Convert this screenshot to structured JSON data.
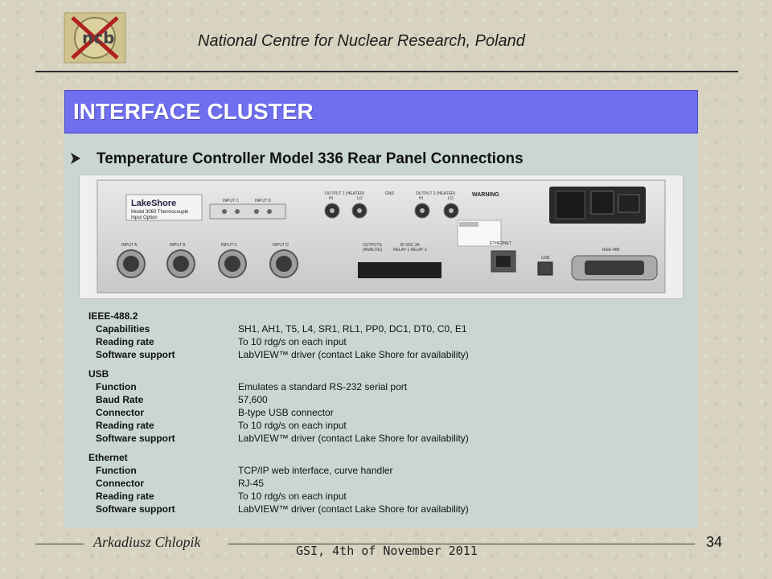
{
  "header": {
    "logo_icon": "ncbj-logo",
    "org_title": "National Centre for Nuclear Research, Poland"
  },
  "slide": {
    "title": "INTERFACE CLUSTER",
    "title_bar_color": "#6f6ff0",
    "bullet_icon": "arrow-bullet-icon",
    "subtitle": "Temperature Controller Model 336 Rear Panel Connections"
  },
  "device": {
    "brand": "LakeShore",
    "module_line1": "Model 3060 Thermocouple",
    "module_line2": "Input Option",
    "top_input_c": "INPUT C",
    "top_input_d": "INPUT D",
    "output1": "OUTPUT 1 (HEATER)",
    "output2": "OUTPUT 2 (HEATER)",
    "hi": "HI",
    "lo": "LO",
    "gnd": "GND",
    "warning": "WARNING",
    "input_a": "INPUT A",
    "input_b": "INPUT B",
    "input_c": "INPUT C",
    "input_d": "INPUT D",
    "outputs": "OUTPUTS",
    "analog": "(ANALOG)",
    "relay_header": "30 VDC 3A",
    "relays": "RELAY 1   RELAY 2",
    "ethernet": "ETHERNET",
    "usb": "USB",
    "ieee": "IEEE-488"
  },
  "specs": [
    {
      "heading": "IEEE-488.2",
      "rows": [
        {
          "key": "Capabilities",
          "value": "SH1, AH1, T5, L4, SR1, RL1, PP0, DC1, DT0, C0, E1"
        },
        {
          "key": "Reading rate",
          "value": "To 10 rdg/s on each input"
        },
        {
          "key": "Software support",
          "value": "LabVIEW™ driver (contact Lake Shore for availability)"
        }
      ]
    },
    {
      "heading": "USB",
      "rows": [
        {
          "key": "Function",
          "value": "Emulates a standard RS-232 serial port"
        },
        {
          "key": "Baud Rate",
          "value": "57,600"
        },
        {
          "key": "Connector",
          "value": "B-type USB connector"
        },
        {
          "key": "Reading rate",
          "value": "To 10 rdg/s on each input"
        },
        {
          "key": "Software support",
          "value": "LabVIEW™ driver (contact Lake Shore for availability)"
        }
      ]
    },
    {
      "heading": "Ethernet",
      "rows": [
        {
          "key": "Function",
          "value": "TCP/IP web interface, curve handler"
        },
        {
          "key": "Connector",
          "value": "RJ-45"
        },
        {
          "key": "Reading rate",
          "value": "To 10 rdg/s on each input"
        },
        {
          "key": "Software support",
          "value": "LabVIEW™ driver (contact Lake Shore for availability)"
        }
      ]
    }
  ],
  "footer": {
    "author": "Arkadiusz Chlopik",
    "event": "GSI, 4th of November 2011",
    "page_number": "34"
  }
}
